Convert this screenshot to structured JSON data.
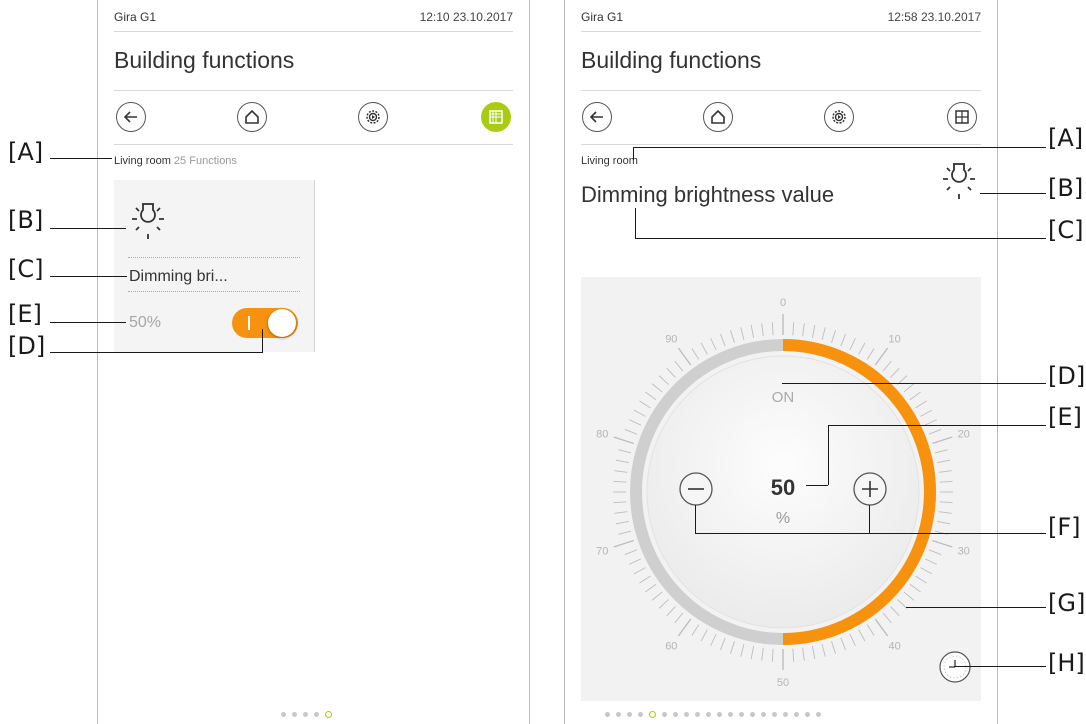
{
  "left_screen": {
    "device": "Gira G1",
    "datetime": "12:10  23.10.2017",
    "title": "Building functions",
    "room": "Living room",
    "count": "25",
    "functions_label": "Functions",
    "tile": {
      "name": "Dimming bri...",
      "value": "50%",
      "switch_on": true
    },
    "page_dots": {
      "count": 5,
      "current": 4
    }
  },
  "right_screen": {
    "device": "Gira G1",
    "datetime": "12:58  23.10.2017",
    "title": "Building functions",
    "room": "Living room",
    "function_name": "Dimming brightness value",
    "state": "ON",
    "value": "50",
    "unit": "%",
    "dial_level_percent": 50,
    "dial_labels": [
      "0",
      "10",
      "20",
      "30",
      "40",
      "50",
      "60",
      "70",
      "80",
      "90"
    ],
    "page_dots": {
      "count": 20,
      "current": 4
    }
  },
  "callouts": {
    "left": [
      "[A]",
      "[B]",
      "[C]",
      "[E]",
      "[D]"
    ],
    "right": [
      "[A]",
      "[B]",
      "[C]",
      "[D]",
      "[E]",
      "[F]",
      "[G]",
      "[H]"
    ]
  },
  "colors": {
    "accent_green": "#a9cc13",
    "accent_orange": "#f7920f",
    "track_grey": "#cfcfcf"
  },
  "icons": [
    "back-arrow-icon",
    "home-icon",
    "settings-gear-icon",
    "grid-icon",
    "light-bulb-icon",
    "minus-icon",
    "plus-icon",
    "timer-clock-icon"
  ]
}
